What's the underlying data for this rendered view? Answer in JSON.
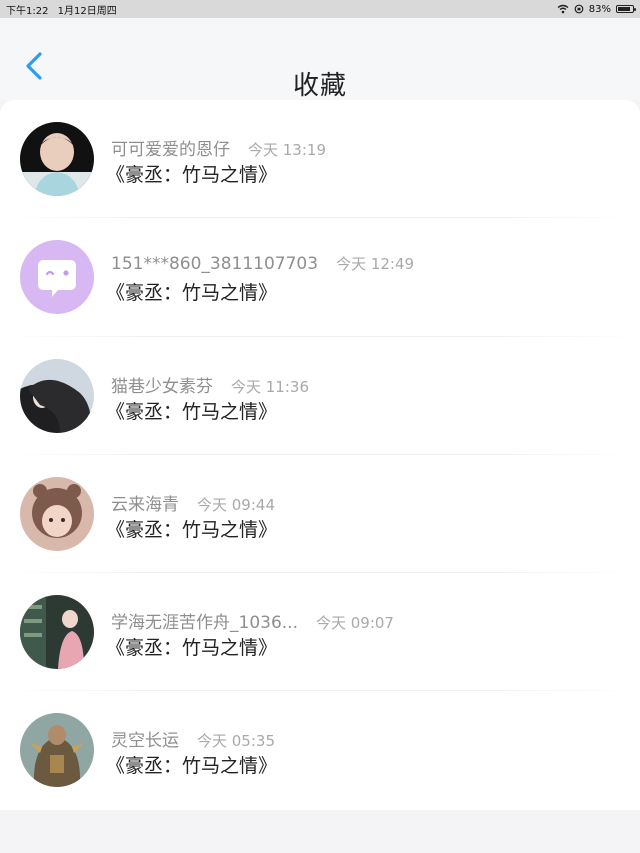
{
  "status_bar": {
    "time": "下午1:22",
    "date": "1月12日周四",
    "battery": "83%",
    "battery_level": 0.83,
    "icons": [
      "wifi-icon",
      "orientation-lock-icon",
      "battery-icon"
    ]
  },
  "header": {
    "title": "收藏",
    "back_icon": "chevron-left-icon",
    "accent_color": "#2a9df4"
  },
  "favorites": [
    {
      "user": "可可爱爱的恩仔",
      "time": "今天 13:19",
      "book": "《豪丞：竹马之情》",
      "avatar": "avatar-photo"
    },
    {
      "user": "151***860_3811107703",
      "time": "今天 12:49",
      "book": "《豪丞：竹马之情》",
      "avatar": "default-avatar-icon"
    },
    {
      "user": "猫巷少女素芬",
      "time": "今天 11:36",
      "book": "《豪丞：竹马之情》",
      "avatar": "avatar-photo"
    },
    {
      "user": "云来海青",
      "time": "今天 09:44",
      "book": "《豪丞：竹马之情》",
      "avatar": "avatar-photo"
    },
    {
      "user": "学海无涯苦作舟_1036...",
      "time": "今天 09:07",
      "book": "《豪丞：竹马之情》",
      "avatar": "avatar-photo"
    },
    {
      "user": "灵空长运",
      "time": "今天 05:35",
      "book": "《豪丞：竹马之情》",
      "avatar": "avatar-photo"
    }
  ]
}
